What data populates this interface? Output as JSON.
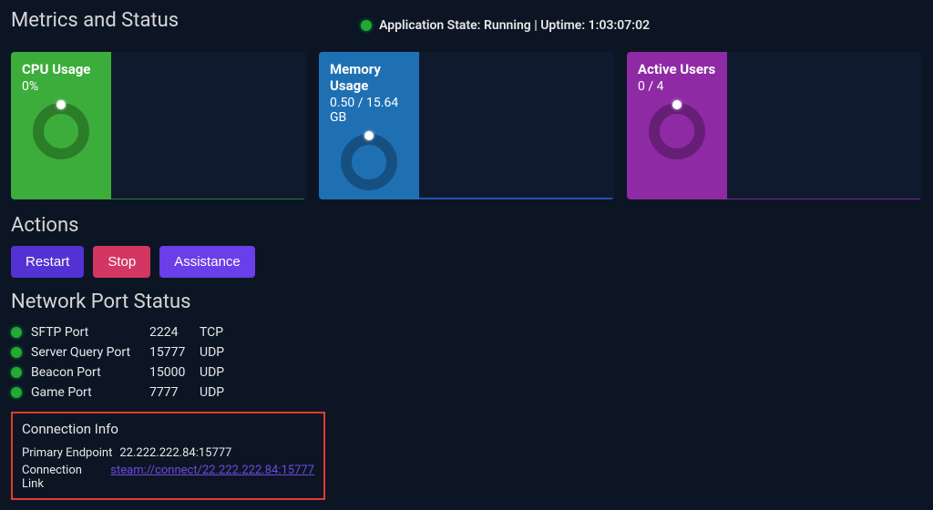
{
  "header": {
    "title": "Metrics and Status",
    "app_state_prefix": "Application State:",
    "app_state_value": "Running",
    "uptime_prefix": "| Uptime:",
    "uptime": "1:03:07:02"
  },
  "cards": {
    "cpu": {
      "label": "CPU Usage",
      "value": "0%"
    },
    "mem": {
      "label": "Memory Usage",
      "value": "0.50 / 15.64 GB"
    },
    "users": {
      "label": "Active Users",
      "value": "0 / 4"
    }
  },
  "actions": {
    "title": "Actions",
    "restart": "Restart",
    "stop": "Stop",
    "assistance": "Assistance"
  },
  "network": {
    "title": "Network Port Status",
    "ports": [
      {
        "name": "SFTP Port",
        "num": "2224",
        "proto": "TCP"
      },
      {
        "name": "Server Query Port",
        "num": "15777",
        "proto": "UDP"
      },
      {
        "name": "Beacon Port",
        "num": "15000",
        "proto": "UDP"
      },
      {
        "name": "Game Port",
        "num": "7777",
        "proto": "UDP"
      }
    ]
  },
  "connection": {
    "title": "Connection Info",
    "endpoint_label": "Primary Endpoint",
    "endpoint_value": "22.222.222.84:15777",
    "link_label": "Connection Link",
    "link_value": "steam://connect/22.222.222.84:15777"
  }
}
